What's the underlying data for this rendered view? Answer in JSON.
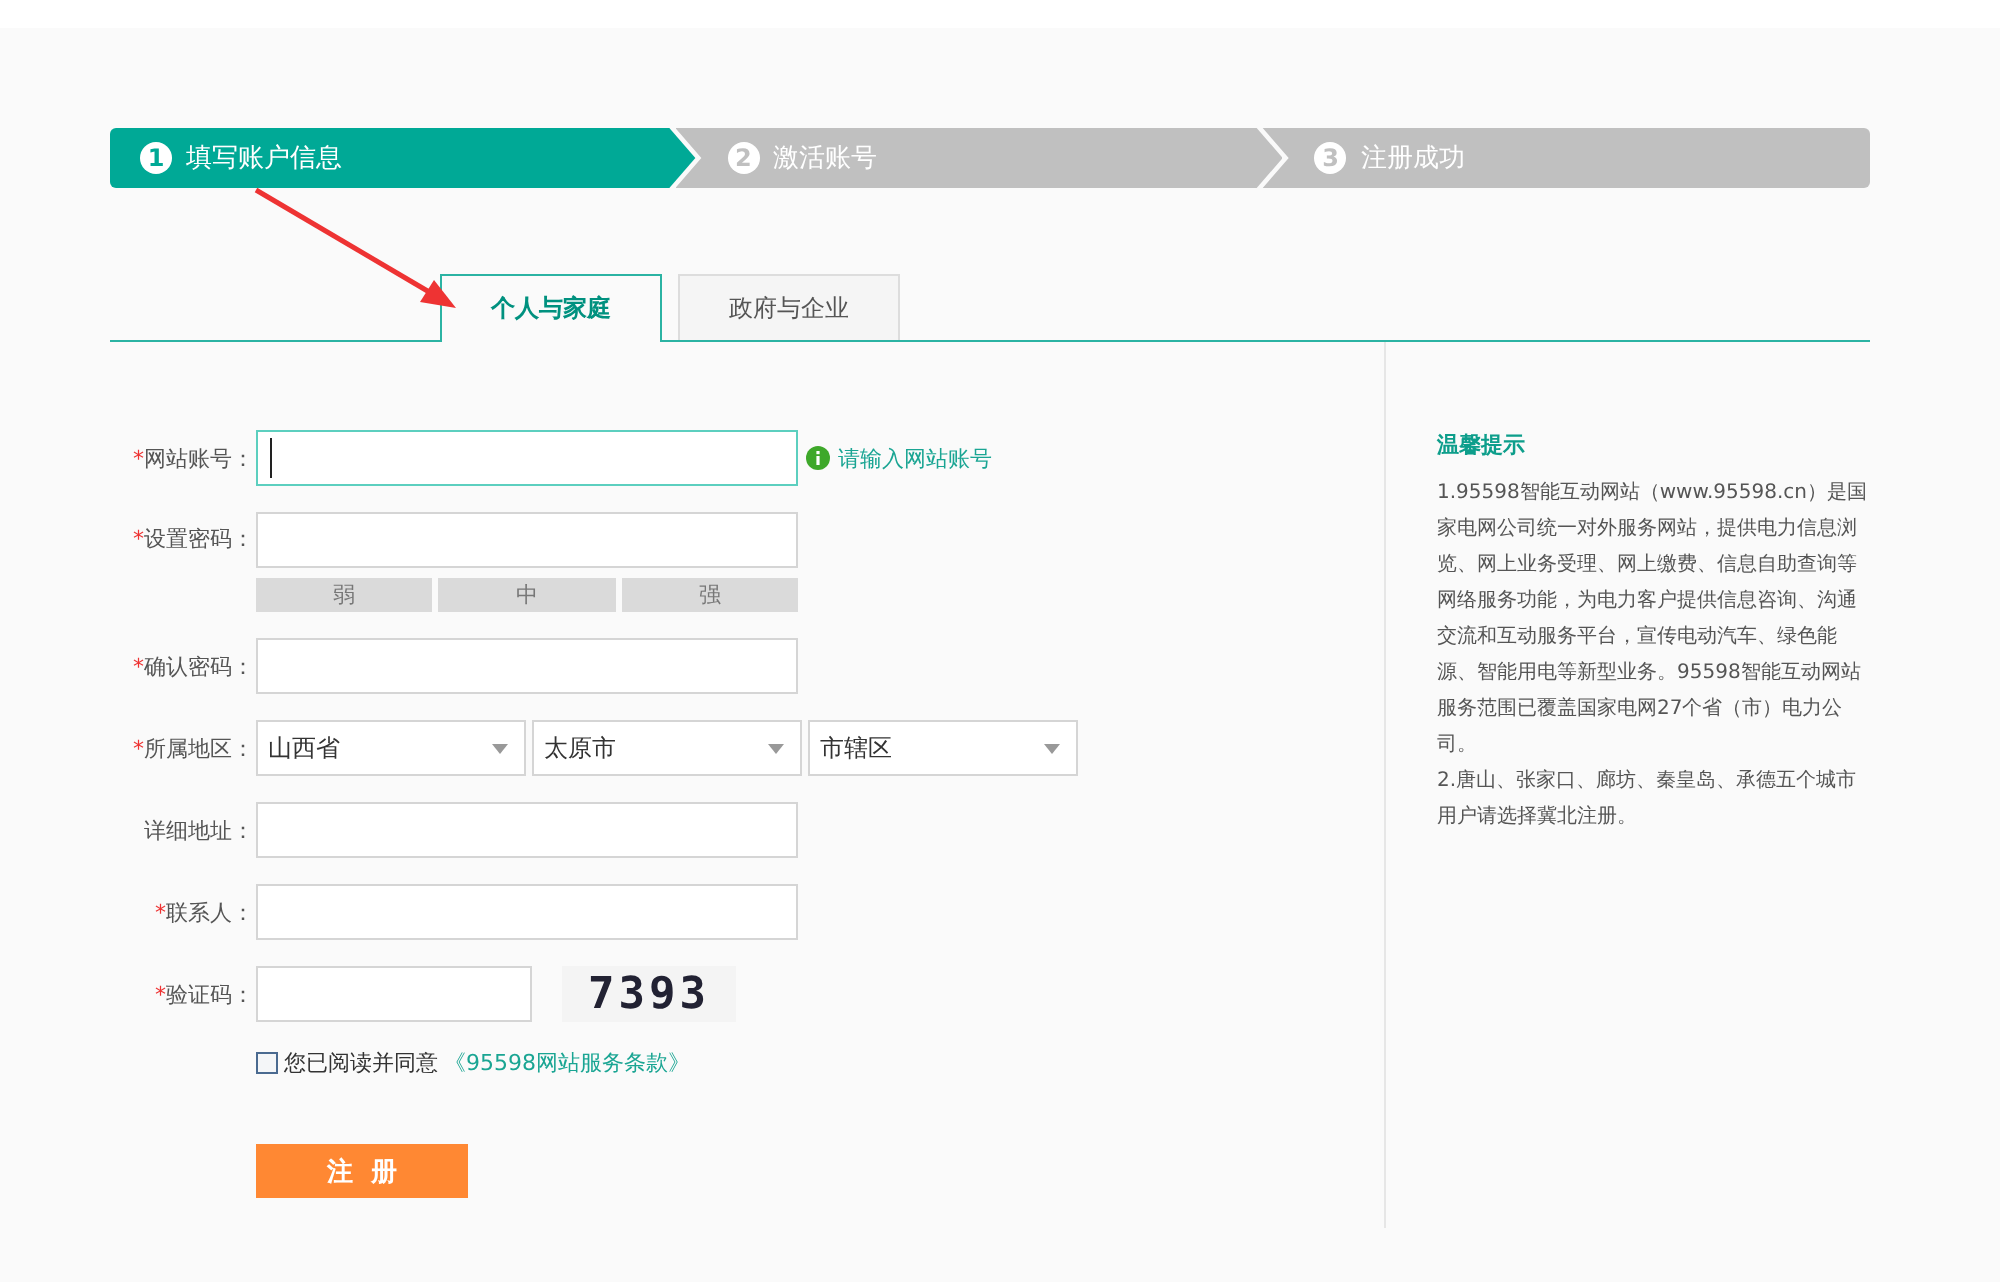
{
  "steps": [
    {
      "number": "1",
      "label": "填写账户信息",
      "selected": true
    },
    {
      "number": "2",
      "label": "激活账号",
      "selected": false
    },
    {
      "number": "3",
      "label": "注册成功",
      "selected": false
    }
  ],
  "tabs": [
    {
      "label": "个人与家庭",
      "selected": true
    },
    {
      "label": "政府与企业",
      "selected": false
    }
  ],
  "form": {
    "fields": [
      {
        "kind": "text",
        "mark": "*",
        "label": "网站账号：",
        "focused": true,
        "hint": "请输入网站账号"
      },
      {
        "kind": "password",
        "mark": "*",
        "label": "设置密码：",
        "focused": false,
        "strength": [
          "弱",
          "中",
          "强"
        ]
      },
      {
        "kind": "text",
        "mark": "*",
        "label": "确认密码：",
        "focused": false
      },
      {
        "kind": "selects",
        "mark": "*",
        "label": "所属地区：",
        "options": [
          "山西省",
          "太原市",
          "市辖区"
        ]
      },
      {
        "kind": "text",
        "label": "详细地址：",
        "focused": false
      },
      {
        "kind": "text",
        "mark": "*",
        "label": "联系人：",
        "focused": false
      },
      {
        "kind": "captcha",
        "mark": "*",
        "label": "验证码：",
        "code": "7393"
      }
    ],
    "agreement": {
      "checked": false,
      "text": "您已阅读并同意",
      "link": "《95598网站服务条款》"
    },
    "submit": "注  册"
  },
  "tips": {
    "title": "温馨提示",
    "paragraphs": [
      "1.95598智能互动网站（www.95598.cn）是国家电网公司统一对外服务网站，提供电力信息浏览、网上业务受理、网上缴费、信息自助查询等网络服务功能，为电力客户提供信息咨询、沟通交流和互动服务平台，宣传电动汽车、绿色能源、智能用电等新型业务。95598智能互动网站服务范围已覆盖国家电网27个省（市）电力公司。",
      "2.唐山、张家口、廊坊、秦皇岛、承德五个城市用户请选择冀北注册。"
    ]
  }
}
